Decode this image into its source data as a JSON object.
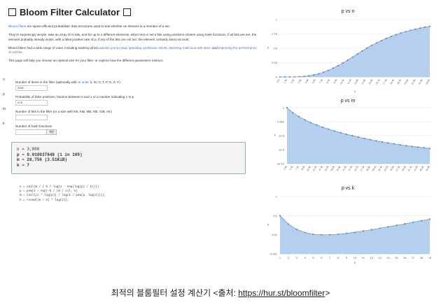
{
  "title": "Bloom Filter Calculator",
  "intro": {
    "p1_link": "Bloom filters",
    "p1_rest": " are space-efficient probablistic data structures used to test whether an element is a member of a set.",
    "p2": "They're surprisingly simple: take an array of m bits, and for up to n different elements, either test or set k bits using positions chosen using hash functions. If all bits are set, the element probably already exists, with a false positive rate of p; if any of the bits are not set, the element certainly does not exist.",
    "p3_start": "Bloom filters find a wide range of uses, including tracking which ",
    "p3_link1": "articles you've read",
    "p3_sep1": ", ",
    "p3_link2": "speeding up Bitcoin clients",
    "p3_sep2": ", ",
    "p3_link3": "detecting malicious web sites",
    "p3_sep3": ", and ",
    "p3_link4": "improving the performance of caches",
    "p3_end": ".",
    "p4": "This page will help you choose an optimal size for your filter, or explore how the different parameters interact."
  },
  "form": [
    {
      "label": "n",
      "text_start": "Number of items in the filter (optionally with ",
      "text_link": "SI units",
      "text_end": ": k, M, G, T, P, E, Z, Y)",
      "value": "3000"
    },
    {
      "label": "p",
      "text_start": "Probability of false positives, fraction between 0 and 1 or a number indicating 1-in-p",
      "text_link": "",
      "text_end": "",
      "value": "0.01"
    },
    {
      "label": "m",
      "text_start": "Number of bits in the filter (or a size with KB, KiB, MB, Mb, GiB, etc)",
      "text_link": "",
      "text_end": "",
      "value": ""
    },
    {
      "label": "k",
      "text_start": "Number of hash functions",
      "text_link": "",
      "text_end": "",
      "value": "",
      "button": "계산"
    }
  ],
  "result": {
    "n_label": "n",
    "n_value": "3,000",
    "p_label": "p",
    "p_value": "0.010037849 (1 in 100)",
    "m_label": "m",
    "m_value": "28,756 (3.51KiB)",
    "k_label": "k",
    "k_value": "7"
  },
  "code": "n = ceil(m / (-k / log(1 - exp(log(p) / k))))\np = pow(1 - exp(-k / (m / n)), k)\nm = ceil((n * log(p)) / log(1 / pow(2, log(2))));\nk = round((m / n) * log(2));",
  "chart_data": [
    {
      "type": "area",
      "title": "p vs n",
      "xlabel": "n",
      "ylabel": "p",
      "x": [
        "375",
        "1.1k",
        "1.9k",
        "2.6k",
        "3.4k",
        "4.1k",
        "4.9k",
        "5.6k",
        "6.4k",
        "7.1k",
        "7.9k",
        "8.6k",
        "9.4k",
        "10.1k",
        "10.9k",
        "11.6k",
        "12.4k",
        "13.1k",
        "13.9k",
        "14.6k",
        "15.4k",
        "16.1k",
        "16.9k",
        "17.6k",
        "18.4k",
        "19.1k",
        "19.9k",
        "20.6k",
        "21.4k",
        "22.1k",
        "22.9k",
        "23.6k"
      ],
      "y": [
        0,
        0,
        0,
        0.001,
        0.004,
        0.01,
        0.02,
        0.035,
        0.055,
        0.082,
        0.115,
        0.152,
        0.195,
        0.242,
        0.293,
        0.345,
        0.4,
        0.453,
        0.503,
        0.55,
        0.594,
        0.635,
        0.672,
        0.706,
        0.737,
        0.765,
        0.79,
        0.813,
        0.833,
        0.851,
        0.867,
        0.882
      ],
      "yticks": [
        "0",
        "0.25",
        "0.5",
        "0.75",
        "1"
      ],
      "xticks": [
        "375",
        "1.5k",
        "2.6k",
        "3.8k",
        "4.9k",
        "6.0k",
        "7.1k",
        "8.3k",
        "9.4k",
        "10.5k",
        "11.6k",
        "12.8k",
        "13.9k",
        "15.0k",
        "16.1k",
        "17.3k",
        "18.4k",
        "19.5k",
        "20.6k",
        "21.8k",
        "22.9k",
        "23.6k"
      ],
      "ylim": [
        0,
        1
      ],
      "grid": true
    },
    {
      "type": "area",
      "title": "p vs m",
      "xlabel": "",
      "ylabel": "p",
      "x": [
        "3.5k",
        "5.3k",
        "7.2k",
        "9.0k",
        "10.8k",
        "12.6k",
        "14.4k",
        "16.2k",
        "18.0k",
        "19.8k",
        "21.6k",
        "23.4k",
        "25.2k",
        "27.0k",
        "28.8k",
        "30.6k",
        "32.4k",
        "34.2k",
        "36.0k",
        "37.8k",
        "39.6k",
        "41.4k",
        "43.2k",
        "45.0k",
        "46.8k"
      ],
      "y_log10": [
        0,
        -1.1,
        -1.9,
        -2.6,
        -3.2,
        -3.7,
        -4.2,
        -4.6,
        -5.0,
        -5.35,
        -5.7,
        -6.0,
        -6.3,
        -6.6,
        -6.85,
        -7.1,
        -7.35,
        -7.55,
        -7.75,
        -7.95,
        -8.15,
        -8.3,
        -8.45,
        -8.6,
        -8.75
      ],
      "yticks": [
        "1",
        "0.001",
        "1e-6",
        "1e-9",
        "1e-12"
      ],
      "xticks": [
        "3.5k",
        "5.3k",
        "7.2k",
        "9.0k",
        "10.8k",
        "12.6k",
        "14.4k",
        "16.2k",
        "18.0k",
        "19.8k",
        "21.6k",
        "23.4k",
        "25.2k",
        "27.0k",
        "28.8k",
        "30.6k",
        "32.4k",
        "34.2k",
        "36.0k",
        "37.8k",
        "39.6k",
        "41.4k",
        "43.2k",
        "45.0k",
        "46.8k"
      ],
      "ylim_log10": [
        -12,
        0
      ],
      "grid": true
    },
    {
      "type": "area",
      "title": "p vs k",
      "xlabel": "k",
      "ylabel": "p",
      "x": [
        1,
        2,
        3,
        4,
        5,
        6,
        7,
        8,
        9,
        10,
        11,
        12,
        13,
        14,
        15,
        16,
        17,
        18,
        19
      ],
      "y": [
        0.099,
        0.036,
        0.019,
        0.013,
        0.0105,
        0.0099,
        0.01,
        0.0106,
        0.0118,
        0.0134,
        0.0156,
        0.0183,
        0.0218,
        0.026,
        0.031,
        0.037,
        0.045,
        0.054,
        0.065
      ],
      "yticks": [
        "1",
        "0.1",
        "0.01",
        "0.001"
      ],
      "xticks": [
        "1",
        "2",
        "3",
        "4",
        "5",
        "6",
        "7",
        "8",
        "9",
        "10",
        "11",
        "12",
        "13",
        "14",
        "15",
        "16",
        "17",
        "18",
        "19"
      ],
      "ylim": [
        0.001,
        1
      ],
      "scale": "log",
      "grid": true
    }
  ],
  "caption": {
    "text": "최적의 블룸필터 설정 계산기 <출처: ",
    "link": "https://hur.st/bloomfilter",
    "end": ">"
  },
  "colors": {
    "fill": "#a8c8ec",
    "line": "#6a9bd8",
    "point": "#5b88c6",
    "link": "#3b6fd8"
  }
}
